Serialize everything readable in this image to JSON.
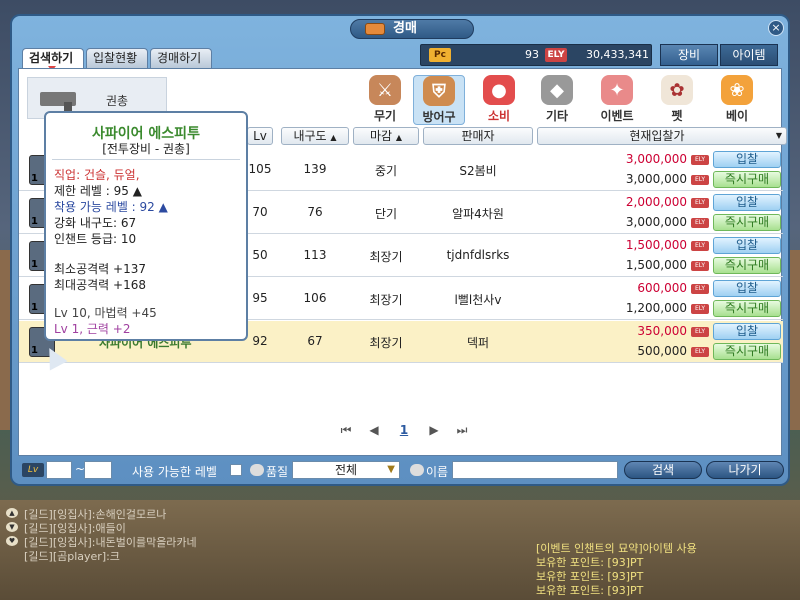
{
  "window": {
    "title": "경매",
    "close": "×"
  },
  "tabs": {
    "search": "검색하기",
    "bid_status": "입찰현황",
    "sell": "경매하기"
  },
  "currency": {
    "pc_label": "Pc",
    "pc_value": "93",
    "ely_label": "ELY",
    "ely_value": "30,433,341"
  },
  "right_tabs": {
    "equip": "장비",
    "item": "아이템"
  },
  "sub_category": {
    "label": "권총",
    "icon": "gun-icon"
  },
  "categories": [
    {
      "label": "무기",
      "icon": "sword-icon"
    },
    {
      "label": "방어구",
      "icon": "armor-icon"
    },
    {
      "label": "소비",
      "icon": "potion-icon"
    },
    {
      "label": "기타",
      "icon": "etc-icon"
    },
    {
      "label": "이벤트",
      "icon": "ticket-icon"
    },
    {
      "label": "펫",
      "icon": "pet-icon"
    },
    {
      "label": "베이",
      "icon": "bay-icon"
    }
  ],
  "columns": {
    "level": "Lv",
    "durability": "내구도",
    "time": "마감",
    "seller": "판매자",
    "price": "현재입찰가"
  },
  "rows": [
    {
      "qty": "1",
      "name": "",
      "lv": "105",
      "durability": "139",
      "time": "중기",
      "seller": "S2봄비",
      "bid": "3,000,000",
      "buy": "3,000,000"
    },
    {
      "qty": "1",
      "name": "",
      "lv": "70",
      "durability": "76",
      "time": "단기",
      "seller": "알파4차원",
      "bid": "2,000,000",
      "buy": "3,000,000"
    },
    {
      "qty": "1",
      "name": "",
      "lv": "50",
      "durability": "113",
      "time": "최장기",
      "seller": "tjdnfdlsrks",
      "bid": "1,500,000",
      "buy": "1,500,000"
    },
    {
      "qty": "1",
      "name": "",
      "lv": "95",
      "durability": "106",
      "time": "최장기",
      "seller": "l뻘l천사v",
      "bid": "600,000",
      "buy": "1,200,000"
    },
    {
      "qty": "1",
      "name": "사파이어 에스피투",
      "lv": "92",
      "durability": "67",
      "time": "최장기",
      "seller": "덱퍼",
      "bid": "350,000",
      "buy": "500,000"
    }
  ],
  "row_buttons": {
    "bid": "입찰",
    "buy": "즉시구매",
    "ely": "ELY"
  },
  "pagination": {
    "current": "1"
  },
  "search": {
    "lv_label": "Lv",
    "lv_min": "",
    "lv_max": "",
    "tilde": "~",
    "usable_label": "사용 가능한 레벨",
    "grade_label": "품질",
    "grade_value": "전체",
    "name_label": "이름",
    "name_value": "",
    "search_button": "검색",
    "exit_button": "나가기"
  },
  "tooltip": {
    "name": "사파이어 에스피투",
    "type": "[전투장비 - 권총]",
    "job": "직업: 건슬, 듀얼,",
    "req_level": "제한 레벨 : 95 ▲",
    "equip_level": "착용 가능 레벨 : 92 ▲",
    "durability": "강화 내구도: 67",
    "enchant": "인챈트 등급: 10",
    "min_atk": "최소공격력 +137",
    "max_atk": "최대공격력 +168",
    "magic": "Lv 10, 마법력 +45",
    "strength": "Lv 1, 근력 +2"
  },
  "chat": [
    "[길드][잉집사]:손해인걸모르나",
    "[길드][잉집사]:애들이",
    "[길드][잉집사]:내돈벌이를막을라카네",
    "[길드][곰player]:크"
  ],
  "event_log": [
    "[이벤트 인챈트의 묘약]아이템 사용",
    "보유한 포인트: [93]PT",
    "보유한 포인트: [93]PT",
    "보유한 포인트: [93]PT"
  ]
}
